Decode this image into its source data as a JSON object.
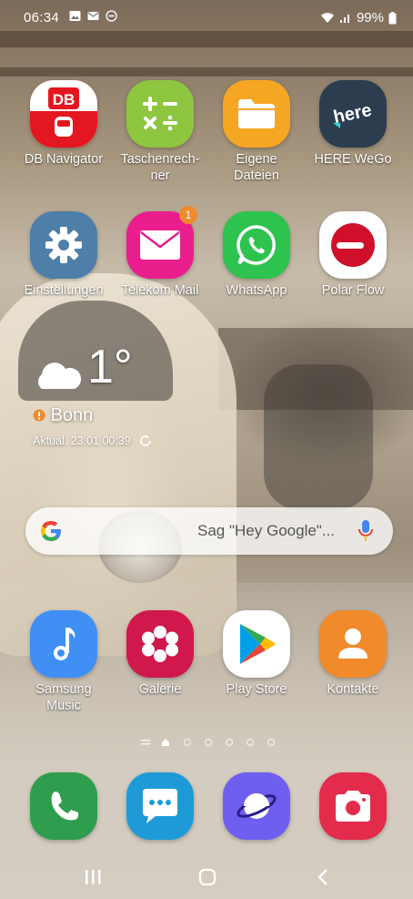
{
  "status": {
    "time": "06:34",
    "battery": "99%"
  },
  "apps_row1": [
    {
      "label": "DB Navigator",
      "icon": "db-logo-icon",
      "color": "#e4161f"
    },
    {
      "label": "Taschenrech-\nner",
      "icon": "calculator-icon",
      "color": "#8ec63f"
    },
    {
      "label": "Eigene\nDateien",
      "icon": "folder-icon",
      "color": "#f5a623"
    },
    {
      "label": "HERE WeGo",
      "icon": "here-logo-icon",
      "color": "#2b3d4f"
    }
  ],
  "apps_row2": [
    {
      "label": "Einstellungen",
      "icon": "gear-icon",
      "color": "#4e7fa8"
    },
    {
      "label": "Telekom Mail",
      "icon": "mail-icon",
      "color": "#e91e8c",
      "badge": "1"
    },
    {
      "label": "WhatsApp",
      "icon": "whatsapp-icon",
      "color": "#2ec24f"
    },
    {
      "label": "Polar Flow",
      "icon": "polar-icon",
      "color": "#ffffff"
    }
  ],
  "weather": {
    "temp": "1°",
    "city": "Bonn",
    "updated": "Aktual. 23.01 00:39"
  },
  "search": {
    "placeholder": "Sag \"Hey Google\"..."
  },
  "apps_row3": [
    {
      "label": "Samsung\nMusic",
      "icon": "music-note-icon",
      "color": "#3f8ff5"
    },
    {
      "label": "Galerie",
      "icon": "flower-icon",
      "color": "#d0184c"
    },
    {
      "label": "Play Store",
      "icon": "play-store-icon",
      "color": "#ffffff"
    },
    {
      "label": "Kontakte",
      "icon": "contact-icon",
      "color": "#f08a2b"
    }
  ],
  "dock": [
    {
      "name": "phone",
      "icon": "phone-icon",
      "color": "#2e9e4e"
    },
    {
      "name": "messages",
      "icon": "chat-icon",
      "color": "#1e9bd7"
    },
    {
      "name": "internet",
      "icon": "planet-icon",
      "color": "#6f5ff0"
    },
    {
      "name": "camera",
      "icon": "camera-icon",
      "color": "#e32b4b"
    }
  ],
  "page_indicator": {
    "count": 5,
    "active": 0
  }
}
